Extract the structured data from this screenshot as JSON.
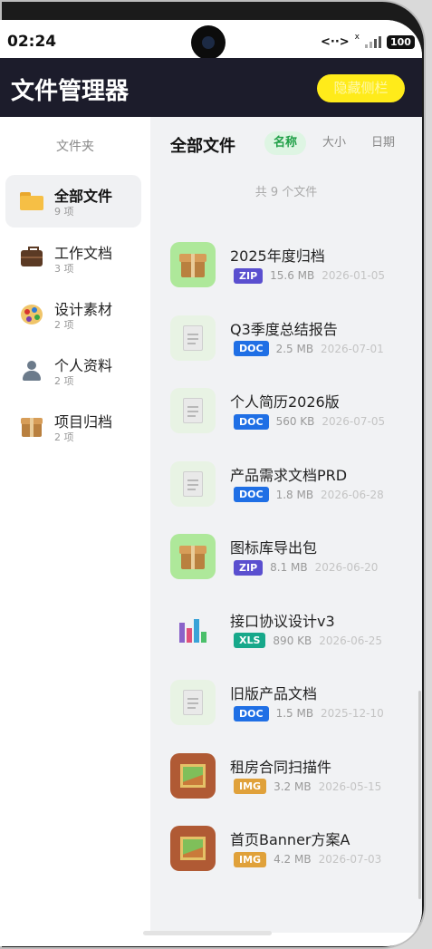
{
  "status_bar": {
    "time": "02:24",
    "data_indicator": "<··>",
    "network_sup": "x",
    "battery": "100"
  },
  "header": {
    "title": "文件管理器",
    "hide_sidebar_label": "隐藏侧栏",
    "accent_color": "#ffeb1a",
    "background_color": "#1c1c2b"
  },
  "sidebar": {
    "heading": "文件夹",
    "items": [
      {
        "label": "全部文件",
        "count": "9 项",
        "icon": "folder-icon",
        "active": true
      },
      {
        "label": "工作文档",
        "count": "3 项",
        "icon": "briefcase-icon",
        "active": false
      },
      {
        "label": "设计素材",
        "count": "2 项",
        "icon": "palette-icon",
        "active": false
      },
      {
        "label": "个人资料",
        "count": "2 项",
        "icon": "person-icon",
        "active": false
      },
      {
        "label": "项目归档",
        "count": "2 项",
        "icon": "box-icon",
        "active": false
      }
    ]
  },
  "main": {
    "title": "全部文件",
    "sort_tabs": [
      {
        "label": "名称",
        "active": true
      },
      {
        "label": "大小",
        "active": false
      },
      {
        "label": "日期",
        "active": false
      }
    ],
    "file_count": "共 9 个文件",
    "badge_colors": {
      "ZIP": "#5a4fcf",
      "DOC": "#1f6fe5",
      "XLS": "#17a88a",
      "IMG": "#e0a13a"
    },
    "files": [
      {
        "name": "2025年度归档",
        "type": "ZIP",
        "size": "15.6 MB",
        "date": "2026-01-05",
        "icon": "box-icon"
      },
      {
        "name": "Q3季度总结报告",
        "type": "DOC",
        "size": "2.5 MB",
        "date": "2026-07-01",
        "icon": "document-icon"
      },
      {
        "name": "个人简历2026版",
        "type": "DOC",
        "size": "560 KB",
        "date": "2026-07-05",
        "icon": "document-icon"
      },
      {
        "name": "产品需求文档PRD",
        "type": "DOC",
        "size": "1.8 MB",
        "date": "2026-06-28",
        "icon": "document-icon"
      },
      {
        "name": "图标库导出包",
        "type": "ZIP",
        "size": "8.1 MB",
        "date": "2026-06-20",
        "icon": "box-icon"
      },
      {
        "name": "接口协议设计v3",
        "type": "XLS",
        "size": "890 KB",
        "date": "2026-06-25",
        "icon": "bar-chart-icon"
      },
      {
        "name": "旧版产品文档",
        "type": "DOC",
        "size": "1.5 MB",
        "date": "2025-12-10",
        "icon": "document-icon"
      },
      {
        "name": "租房合同扫描件",
        "type": "IMG",
        "size": "3.2 MB",
        "date": "2026-05-15",
        "icon": "picture-icon"
      },
      {
        "name": "首页Banner方案A",
        "type": "IMG",
        "size": "4.2 MB",
        "date": "2026-07-03",
        "icon": "picture-icon"
      }
    ]
  }
}
